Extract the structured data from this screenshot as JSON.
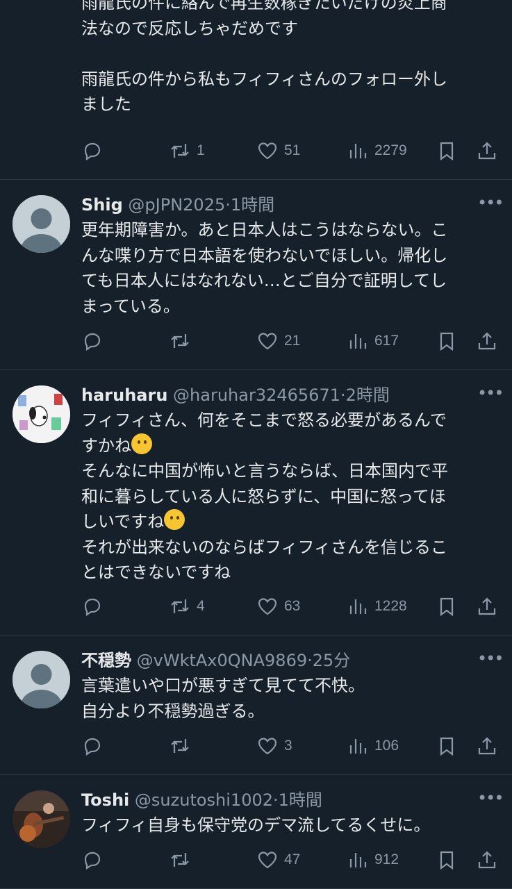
{
  "tweets": [
    {
      "lines": [
        "雨龍氏の件に絡んで再生数稼ぎたいだけの炎上商",
        "法なので反応しちゃだめです",
        "",
        "雨龍氏の件から私もフィフィさんのフォロー外し",
        "ました"
      ],
      "stats": {
        "replies": "",
        "retweets": "1",
        "likes": "51",
        "views": "2279"
      }
    },
    {
      "name": "Shig",
      "handle": "@pJPN2025",
      "time": "1時間",
      "avatar": "default-avatar",
      "lines": [
        "更年期障害か。あと日本人はこうはならない。こ",
        "んな喋り方で日本語を使わないでほしい。帰化し",
        "ても日本人にはなれない…とご自分で証明してし",
        "まっている。"
      ],
      "stats": {
        "replies": "",
        "retweets": "",
        "likes": "21",
        "views": "617"
      }
    },
    {
      "name": "haruharu",
      "handle": "@haruhar32465671",
      "time": "2時間",
      "avatar": "snoopy-avatar",
      "lines": [
        "フィフィさん、何をそこまで怒る必要があるんで",
        "すかね",
        "そんなに中国が怖いと言うならば、日本国内で平",
        "和に暮らしている人に怒らずに、中国に怒ってほ",
        "しいですね",
        "それが出来ないのならばフィフィさんを信じるこ",
        "とはできないですね"
      ],
      "emoji": "thinking-face-emoji",
      "stats": {
        "replies": "",
        "retweets": "4",
        "likes": "63",
        "views": "1228"
      }
    },
    {
      "name": "不穏勢",
      "handle": "@vWktAx0QNA9869",
      "time": "25分",
      "avatar": "default-avatar",
      "lines": [
        "言葉遣いや口が悪すぎて見てて不快。",
        "自分より不穏勢過ぎる。"
      ],
      "stats": {
        "replies": "",
        "retweets": "",
        "likes": "3",
        "views": "106"
      }
    },
    {
      "name": "Toshi",
      "handle": "@suzutoshi1002",
      "time": "1時間",
      "avatar": "guitar-photo-avatar",
      "lines": [
        "フィフィ自身も保守党のデマ流してるくせに。"
      ],
      "stats": {
        "replies": "",
        "retweets": "",
        "likes": "47",
        "views": "912"
      }
    }
  ],
  "separator": "·",
  "icons": [
    "reply-icon",
    "retweet-icon",
    "heart-icon",
    "views-icon",
    "bookmark-icon",
    "share-icon",
    "more-icon"
  ],
  "colors": {
    "background": "#15202b",
    "text": "#e7e9ea",
    "muted": "#8b98a5",
    "divider": "#2f3a45"
  }
}
